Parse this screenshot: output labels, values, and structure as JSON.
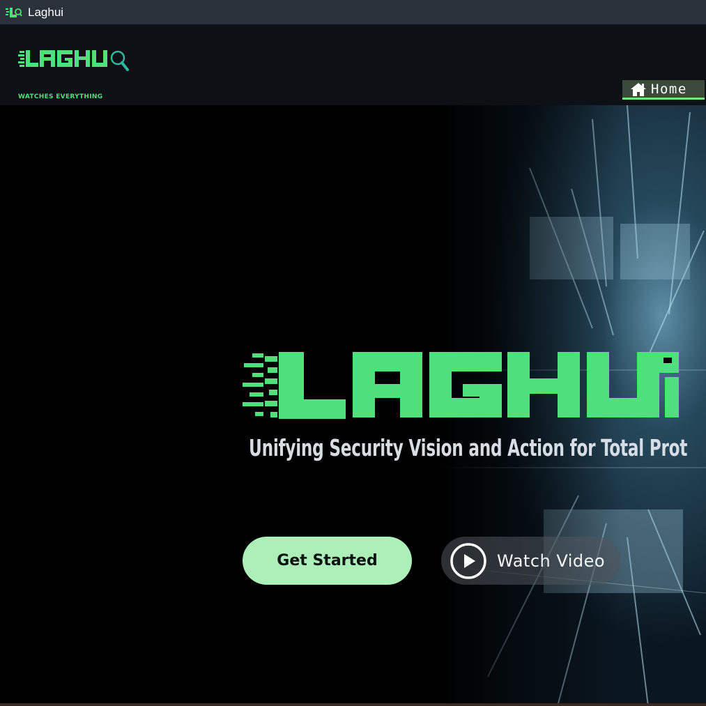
{
  "window": {
    "title": "Laghui",
    "icon": "laghui-app-icon"
  },
  "header": {
    "brand_name": "LAGHUI",
    "brand_tagline": "WATCHES EVERYTHING",
    "nav": [
      {
        "label": "Home",
        "icon": "home-icon"
      }
    ]
  },
  "hero": {
    "logo_text": "LAGHUI",
    "tagline": "Unifying Security Vision and Action for Total Prot",
    "primary_cta": "Get Started",
    "secondary_cta": "Watch Video",
    "secondary_icon": "play-icon"
  },
  "colors": {
    "brand_green": "#4ee07a",
    "cta_green": "#adefb8",
    "header_bg": "#0d1015",
    "titlebar_bg": "#2b313b"
  }
}
